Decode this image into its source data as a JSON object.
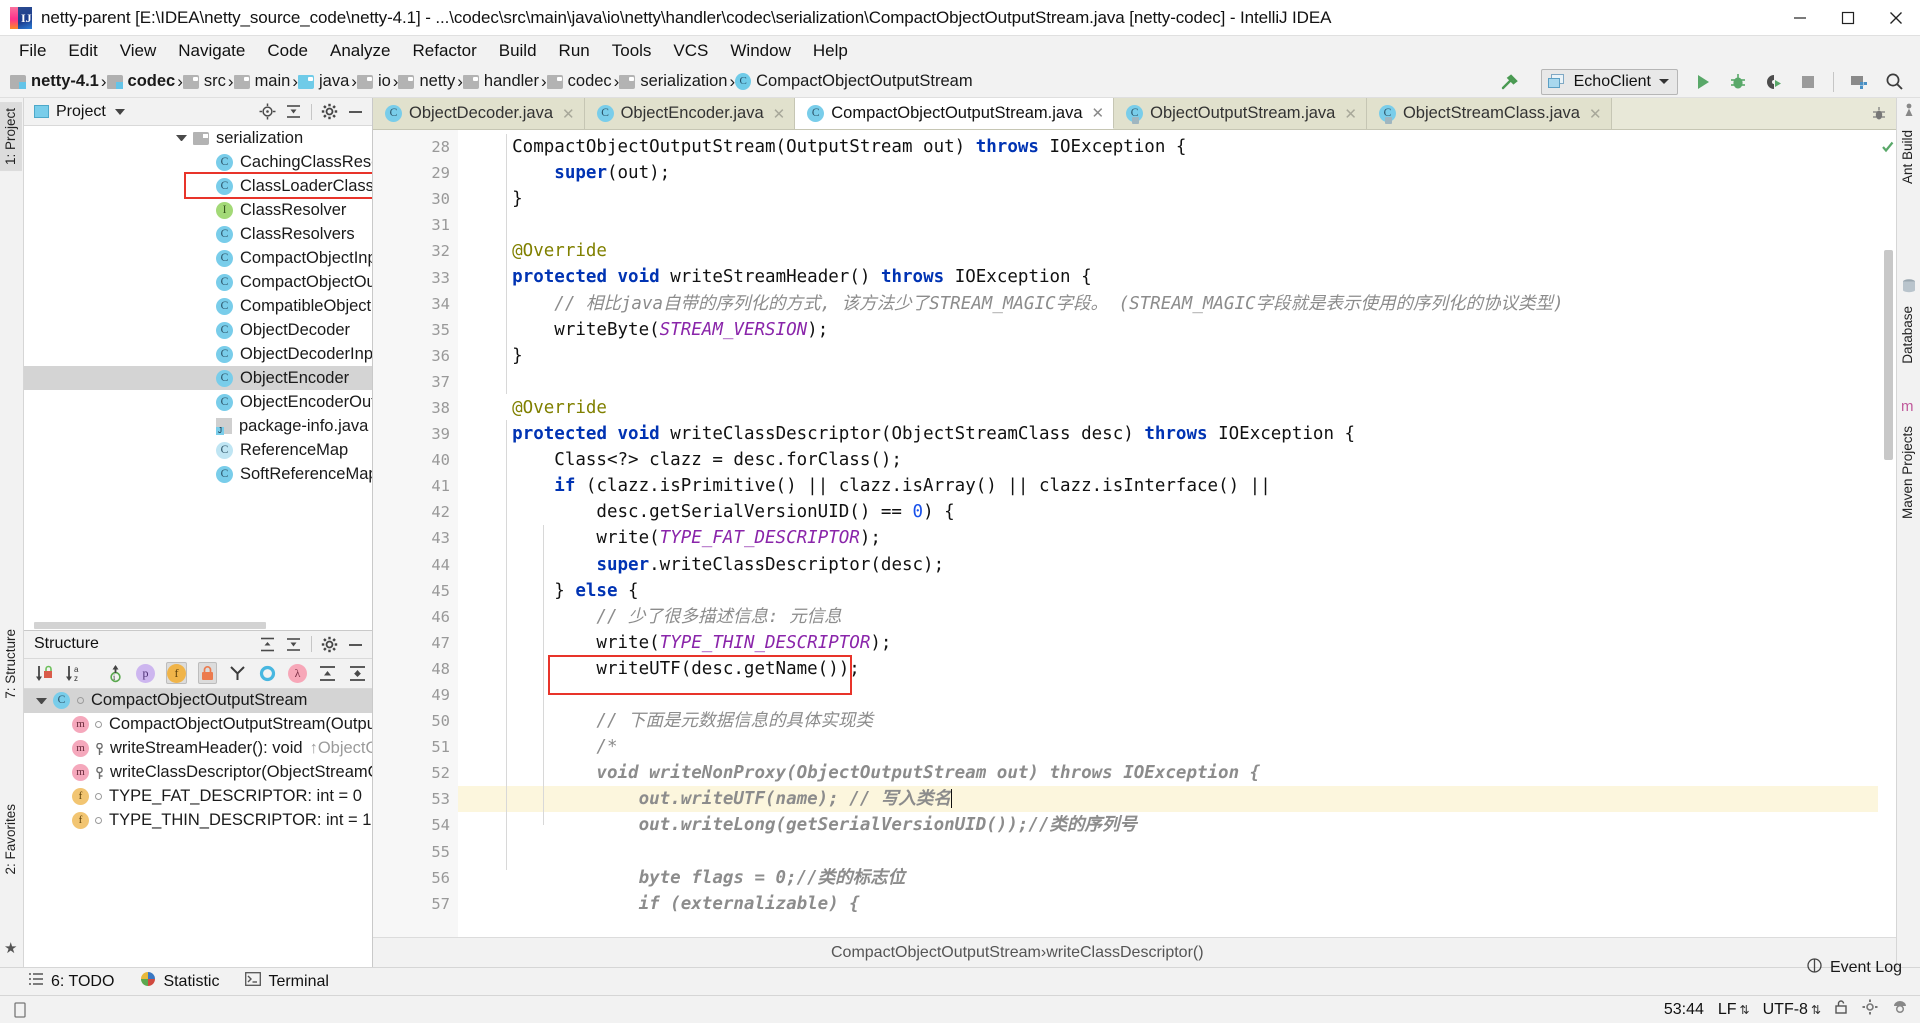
{
  "window": {
    "title": "netty-parent [E:\\IDEA\\netty_source_code\\netty-4.1] - ...\\codec\\src\\main\\java\\io\\netty\\handler\\codec\\serialization\\CompactObjectOutputStream.java [netty-codec] - IntelliJ IDEA",
    "minimize": "minimize-button",
    "maximize": "maximize-button",
    "close": "close-button"
  },
  "menubar": {
    "items": [
      {
        "label": "File",
        "mnemonic": "F"
      },
      {
        "label": "Edit",
        "mnemonic": "E"
      },
      {
        "label": "View",
        "mnemonic": "V"
      },
      {
        "label": "Navigate",
        "mnemonic": "N"
      },
      {
        "label": "Code",
        "mnemonic": "C"
      },
      {
        "label": "Analyze",
        "mnemonic": "z"
      },
      {
        "label": "Refactor",
        "mnemonic": "R"
      },
      {
        "label": "Build",
        "mnemonic": "B"
      },
      {
        "label": "Run",
        "mnemonic": "u"
      },
      {
        "label": "Tools",
        "mnemonic": "T"
      },
      {
        "label": "VCS",
        "mnemonic": "S"
      },
      {
        "label": "Window",
        "mnemonic": "W"
      },
      {
        "label": "Help",
        "mnemonic": "H"
      }
    ]
  },
  "navbar": {
    "crumbs": [
      {
        "label": "netty-4.1",
        "icon": "module-icon",
        "bold": true
      },
      {
        "label": "codec",
        "icon": "module-icon",
        "bold": true
      },
      {
        "label": "src",
        "icon": "folder-icon",
        "bold": false
      },
      {
        "label": "main",
        "icon": "folder-icon",
        "bold": false
      },
      {
        "label": "java",
        "icon": "source-folder-icon",
        "bold": false
      },
      {
        "label": "io",
        "icon": "package-icon",
        "bold": false
      },
      {
        "label": "netty",
        "icon": "package-icon",
        "bold": false
      },
      {
        "label": "handler",
        "icon": "package-icon",
        "bold": false
      },
      {
        "label": "codec",
        "icon": "package-icon",
        "bold": false
      },
      {
        "label": "serialization",
        "icon": "package-icon",
        "bold": false
      },
      {
        "label": "CompactObjectOutputStream",
        "icon": "class-icon",
        "bold": false
      }
    ],
    "run_config": "EchoClient",
    "tools": [
      "build-hammer-icon",
      "run-icon",
      "debug-icon",
      "run-coverage-icon",
      "stop-icon",
      "project-structure-icon",
      "search-everywhere-icon"
    ]
  },
  "left_strips": {
    "top": [
      "1: Project"
    ],
    "structure": "7: Structure",
    "favorites": "2: Favorites"
  },
  "right_strips": [
    "Ant Build",
    "Database",
    "Maven Projects"
  ],
  "project_panel": {
    "title": "Project",
    "actions": [
      "locate-icon",
      "collapse-all-icon",
      "settings-gear-icon",
      "hide-icon"
    ],
    "tree": [
      {
        "label": "serialization",
        "type": "folder",
        "indent": 148,
        "arrow": true,
        "selected": false,
        "highlight": false
      },
      {
        "label": "CachingClassResolver",
        "type": "class",
        "indent": 188,
        "arrow": false,
        "selected": false,
        "highlight": false
      },
      {
        "label": "ClassLoaderClassResol",
        "type": "class",
        "indent": 188,
        "arrow": false,
        "selected": false,
        "highlight": true
      },
      {
        "label": "ClassResolver",
        "type": "interface",
        "indent": 188,
        "arrow": false,
        "selected": false,
        "highlight": false
      },
      {
        "label": "ClassResolvers",
        "type": "class-final",
        "indent": 188,
        "arrow": false,
        "selected": false,
        "highlight": false
      },
      {
        "label": "CompactObjectInputS",
        "type": "class",
        "indent": 188,
        "arrow": false,
        "selected": false,
        "highlight": false
      },
      {
        "label": "CompactObjectOutpu",
        "type": "class",
        "indent": 188,
        "arrow": false,
        "selected": false,
        "highlight": false
      },
      {
        "label": "CompatibleObjectEnc",
        "type": "class",
        "indent": 188,
        "arrow": false,
        "selected": false,
        "highlight": false
      },
      {
        "label": "ObjectDecoder",
        "type": "class",
        "indent": 188,
        "arrow": false,
        "selected": false,
        "highlight": false
      },
      {
        "label": "ObjectDecoderInputSt",
        "type": "class",
        "indent": 188,
        "arrow": false,
        "selected": false,
        "highlight": false
      },
      {
        "label": "ObjectEncoder",
        "type": "class",
        "indent": 188,
        "arrow": false,
        "selected": true,
        "highlight": false
      },
      {
        "label": "ObjectEncoderOutput",
        "type": "class",
        "indent": 188,
        "arrow": false,
        "selected": false,
        "highlight": false
      },
      {
        "label": "package-info.java",
        "type": "javafile",
        "indent": 188,
        "arrow": false,
        "selected": false,
        "highlight": false
      },
      {
        "label": "ReferenceMap",
        "type": "class-ghost",
        "indent": 188,
        "arrow": false,
        "selected": false,
        "highlight": false
      },
      {
        "label": "SoftReferenceMap",
        "type": "class-final",
        "indent": 188,
        "arrow": false,
        "selected": false,
        "highlight": false
      }
    ]
  },
  "structure_panel": {
    "title": "Structure",
    "actions": [
      "expand-all-icon",
      "collapse-all-icon",
      "settings-gear-icon",
      "hide-icon"
    ],
    "toolbar": [
      {
        "name": "sort-by-visibility-icon",
        "active": false
      },
      {
        "name": "sort-alphabetically-icon",
        "active": false
      },
      {
        "name": "show-inherited-icon",
        "active": false
      },
      {
        "name": "show-properties-icon",
        "active": false
      },
      {
        "name": "show-fields-icon",
        "active": true
      },
      {
        "name": "show-non-public-icon",
        "active": true
      },
      {
        "name": "group-methods-icon",
        "active": false
      },
      {
        "name": "show-anonymous-icon",
        "active": false
      },
      {
        "name": "show-lambdas-icon",
        "active": false
      },
      {
        "name": "expand-all-icon",
        "active": false
      },
      {
        "name": "collapse-all-icon",
        "active": false
      },
      {
        "name": "more-icon",
        "active": false
      }
    ],
    "tree": [
      {
        "label": "CompactObjectOutputStream",
        "kind": "class",
        "indent": 8,
        "arrow": true,
        "selected": true,
        "marker": "dot",
        "suffix": ""
      },
      {
        "label": "CompactObjectOutputStream(OutputStr",
        "kind": "method",
        "indent": 44,
        "arrow": false,
        "selected": false,
        "marker": "dot",
        "suffix": ""
      },
      {
        "label": "writeStreamHeader(): void",
        "kind": "method",
        "indent": 44,
        "arrow": false,
        "selected": false,
        "marker": "key",
        "suffix": "↑ObjectOutpu"
      },
      {
        "label": "writeClassDescriptor(ObjectStreamClass",
        "kind": "method",
        "indent": 44,
        "arrow": false,
        "selected": false,
        "marker": "key",
        "suffix": ""
      },
      {
        "label": "TYPE_FAT_DESCRIPTOR: int = 0",
        "kind": "field",
        "indent": 44,
        "arrow": false,
        "selected": false,
        "marker": "dot",
        "suffix": ""
      },
      {
        "label": "TYPE_THIN_DESCRIPTOR: int = 1",
        "kind": "field",
        "indent": 44,
        "arrow": false,
        "selected": false,
        "marker": "dot",
        "suffix": ""
      }
    ]
  },
  "editor": {
    "tabs": [
      {
        "label": "ObjectDecoder.java",
        "active": false,
        "locked": false
      },
      {
        "label": "ObjectEncoder.java",
        "active": false,
        "locked": false
      },
      {
        "label": "CompactObjectOutputStream.java",
        "active": true,
        "locked": false
      },
      {
        "label": "ObjectOutputStream.java",
        "active": false,
        "locked": true
      },
      {
        "label": "ObjectStreamClass.java",
        "active": false,
        "locked": true
      }
    ],
    "first_line_number": 28,
    "lines": [
      {
        "n": 28,
        "marks": [],
        "fold": "start",
        "highlight": false,
        "tokens": [
          {
            "t": "    CompactObjectOutputStream(OutputStream out) ",
            "c": ""
          },
          {
            "t": "throws",
            "c": "kw"
          },
          {
            "t": " IOException {",
            "c": ""
          }
        ]
      },
      {
        "n": 29,
        "marks": [],
        "fold": "",
        "highlight": false,
        "tokens": [
          {
            "t": "        ",
            "c": ""
          },
          {
            "t": "super",
            "c": "kw"
          },
          {
            "t": "(out);",
            "c": ""
          }
        ]
      },
      {
        "n": 30,
        "marks": [],
        "fold": "end",
        "highlight": false,
        "tokens": [
          {
            "t": "    }",
            "c": ""
          }
        ]
      },
      {
        "n": 31,
        "marks": [],
        "fold": "",
        "highlight": false,
        "tokens": [
          {
            "t": "",
            "c": ""
          }
        ]
      },
      {
        "n": 32,
        "marks": [],
        "fold": "",
        "highlight": false,
        "tokens": [
          {
            "t": "    @Override",
            "c": "ann"
          }
        ]
      },
      {
        "n": 33,
        "marks": [
          "override-gutter-icon"
        ],
        "fold": "start",
        "highlight": false,
        "tokens": [
          {
            "t": "    ",
            "c": ""
          },
          {
            "t": "protected void",
            "c": "kw"
          },
          {
            "t": " writeStreamHeader() ",
            "c": ""
          },
          {
            "t": "throws",
            "c": "kw"
          },
          {
            "t": " IOException {",
            "c": ""
          }
        ]
      },
      {
        "n": 34,
        "marks": [],
        "fold": "",
        "highlight": false,
        "tokens": [
          {
            "t": "        // 相比java自带的序列化的方式, 该方法少了STREAM_MAGIC字段。 (STREAM_MAGIC字段就是表示使用的序列化的协议类型)",
            "c": "cmt"
          }
        ]
      },
      {
        "n": 35,
        "marks": [],
        "fold": "",
        "highlight": false,
        "tokens": [
          {
            "t": "        writeByte(",
            "c": ""
          },
          {
            "t": "STREAM_VERSION",
            "c": "const"
          },
          {
            "t": ");",
            "c": ""
          }
        ]
      },
      {
        "n": 36,
        "marks": [],
        "fold": "end",
        "highlight": false,
        "tokens": [
          {
            "t": "    }",
            "c": ""
          }
        ]
      },
      {
        "n": 37,
        "marks": [],
        "fold": "",
        "highlight": false,
        "tokens": [
          {
            "t": "",
            "c": ""
          }
        ]
      },
      {
        "n": 38,
        "marks": [],
        "fold": "",
        "highlight": false,
        "tokens": [
          {
            "t": "    @Override",
            "c": "ann"
          }
        ]
      },
      {
        "n": 39,
        "marks": [
          "override-gutter-icon"
        ],
        "fold": "start",
        "highlight": false,
        "tokens": [
          {
            "t": "    ",
            "c": ""
          },
          {
            "t": "protected void",
            "c": "kw"
          },
          {
            "t": " writeClassDescriptor(ObjectStreamClass desc) ",
            "c": ""
          },
          {
            "t": "throws",
            "c": "kw"
          },
          {
            "t": " IOException {",
            "c": ""
          }
        ]
      },
      {
        "n": 40,
        "marks": [],
        "fold": "",
        "highlight": false,
        "tokens": [
          {
            "t": "        Class<?> clazz = desc.forClass();",
            "c": ""
          }
        ]
      },
      {
        "n": 41,
        "marks": [],
        "fold": "",
        "highlight": false,
        "tokens": [
          {
            "t": "        ",
            "c": ""
          },
          {
            "t": "if",
            "c": "kw"
          },
          {
            "t": " (clazz.isPrimitive() || clazz.isArray() || clazz.isInterface() ||",
            "c": ""
          }
        ]
      },
      {
        "n": 42,
        "marks": [],
        "fold": "",
        "highlight": false,
        "tokens": [
          {
            "t": "            desc.getSerialVersionUID() == ",
            "c": ""
          },
          {
            "t": "0",
            "c": "num"
          },
          {
            "t": ") {",
            "c": ""
          }
        ]
      },
      {
        "n": 43,
        "marks": [],
        "fold": "",
        "highlight": false,
        "tokens": [
          {
            "t": "            write(",
            "c": ""
          },
          {
            "t": "TYPE_FAT_DESCRIPTOR",
            "c": "const"
          },
          {
            "t": ");",
            "c": ""
          }
        ]
      },
      {
        "n": 44,
        "marks": [],
        "fold": "",
        "highlight": false,
        "tokens": [
          {
            "t": "            ",
            "c": ""
          },
          {
            "t": "super",
            "c": "kw"
          },
          {
            "t": ".writeClassDescriptor(desc);",
            "c": ""
          }
        ]
      },
      {
        "n": 45,
        "marks": [],
        "fold": "",
        "highlight": false,
        "tokens": [
          {
            "t": "        } ",
            "c": ""
          },
          {
            "t": "else",
            "c": "kw"
          },
          {
            "t": " {",
            "c": ""
          }
        ]
      },
      {
        "n": 46,
        "marks": [],
        "fold": "",
        "highlight": false,
        "tokens": [
          {
            "t": "            // 少了很多描述信息: 元信息",
            "c": "cmt"
          }
        ]
      },
      {
        "n": 47,
        "marks": [],
        "fold": "",
        "highlight": false,
        "tokens": [
          {
            "t": "            write(",
            "c": ""
          },
          {
            "t": "TYPE_THIN_DESCRIPTOR",
            "c": "const"
          },
          {
            "t": ");",
            "c": ""
          }
        ]
      },
      {
        "n": 48,
        "marks": [],
        "fold": "",
        "highlight": false,
        "tokens": [
          {
            "t": "            writeUTF(desc.getName());",
            "c": ""
          }
        ]
      },
      {
        "n": 49,
        "marks": [],
        "fold": "",
        "highlight": false,
        "tokens": [
          {
            "t": "",
            "c": ""
          }
        ]
      },
      {
        "n": 50,
        "marks": [],
        "fold": "",
        "highlight": false,
        "tokens": [
          {
            "t": "            // 下面是元数据信息的具体实现类",
            "c": "cmt"
          }
        ]
      },
      {
        "n": 51,
        "marks": [],
        "fold": "",
        "highlight": false,
        "tokens": [
          {
            "t": "            /*",
            "c": "cmt"
          }
        ]
      },
      {
        "n": 52,
        "marks": [],
        "fold": "",
        "highlight": false,
        "tokens": [
          {
            "t": "            void writeNonProxy(ObjectOutputStream out) throws IOException {",
            "c": "cmt-b"
          }
        ]
      },
      {
        "n": 53,
        "marks": [],
        "fold": "",
        "highlight": true,
        "tokens": [
          {
            "t": "                out.writeUTF(name); // 写入类名",
            "c": "cmt-b"
          },
          {
            "t": "|",
            "c": "caret"
          }
        ]
      },
      {
        "n": 54,
        "marks": [],
        "fold": "",
        "highlight": false,
        "tokens": [
          {
            "t": "                out.writeLong(getSerialVersionUID());//类的序列号",
            "c": "cmt-b"
          }
        ]
      },
      {
        "n": 55,
        "marks": [],
        "fold": "",
        "highlight": false,
        "tokens": [
          {
            "t": "",
            "c": ""
          }
        ]
      },
      {
        "n": 56,
        "marks": [],
        "fold": "",
        "highlight": false,
        "tokens": [
          {
            "t": "                byte flags = 0;//类的标志位",
            "c": "cmt-b"
          }
        ]
      },
      {
        "n": 57,
        "marks": [],
        "fold": "",
        "highlight": false,
        "tokens": [
          {
            "t": "                if (externalizable) {",
            "c": "cmt-b"
          }
        ]
      }
    ],
    "annotations": [
      {
        "name": "writeutf-highlight-box",
        "line": 48
      },
      {
        "name": "classloaderclassresolver-highlight-box"
      }
    ],
    "breadcrumb": [
      "CompactObjectOutputStream",
      "writeClassDescriptor()"
    ]
  },
  "bottom_toolwindows": [
    {
      "label": "6: TODO",
      "mnemonic": "6",
      "icon": "todo-icon"
    },
    {
      "label": "Statistic",
      "icon": "statistic-icon"
    },
    {
      "label": "Terminal",
      "icon": "terminal-icon"
    }
  ],
  "event_log": {
    "label": "Event Log",
    "icon": "event-log-icon"
  },
  "statusbar": {
    "caret_position": "53:44",
    "line_separator": "LF",
    "encoding": "UTF-8",
    "icons": [
      "lock-icon",
      "inspections-icon",
      "hector-icon"
    ]
  }
}
